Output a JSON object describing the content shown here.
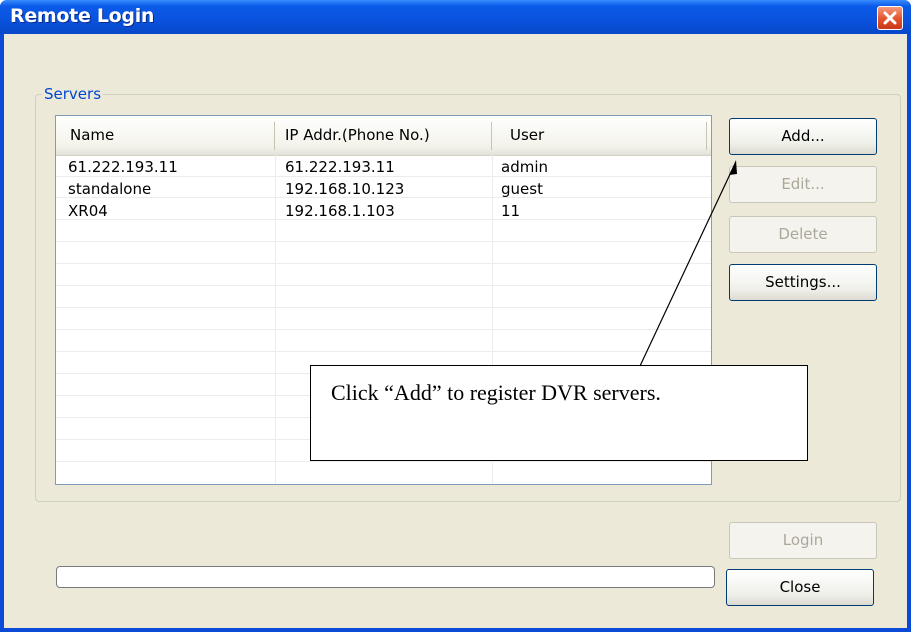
{
  "window": {
    "title": "Remote Login"
  },
  "servers_group": {
    "label": "Servers"
  },
  "columns": [
    "Name",
    "IP Addr.(Phone No.)",
    "User"
  ],
  "rows": [
    {
      "name": "61.222.193.11",
      "ip": "61.222.193.11",
      "user": "admin"
    },
    {
      "name": "standalone",
      "ip": "192.168.10.123",
      "user": "guest"
    },
    {
      "name": "XR04",
      "ip": "192.168.1.103",
      "user": "11"
    }
  ],
  "buttons": {
    "add": "Add...",
    "edit": "Edit...",
    "delete": "Delete",
    "settings": "Settings...",
    "login": "Login",
    "close": "Close"
  },
  "button_states": {
    "edit": "disabled",
    "delete": "disabled",
    "login": "disabled"
  },
  "progress": {
    "value": 0
  },
  "annotation": {
    "text": "Click “Add” to register DVR servers."
  },
  "colors": {
    "title_bar": "#0a52de",
    "dialog_bg": "#ece9d8",
    "group_label": "#0046d5",
    "close_button": "#e2532b"
  }
}
